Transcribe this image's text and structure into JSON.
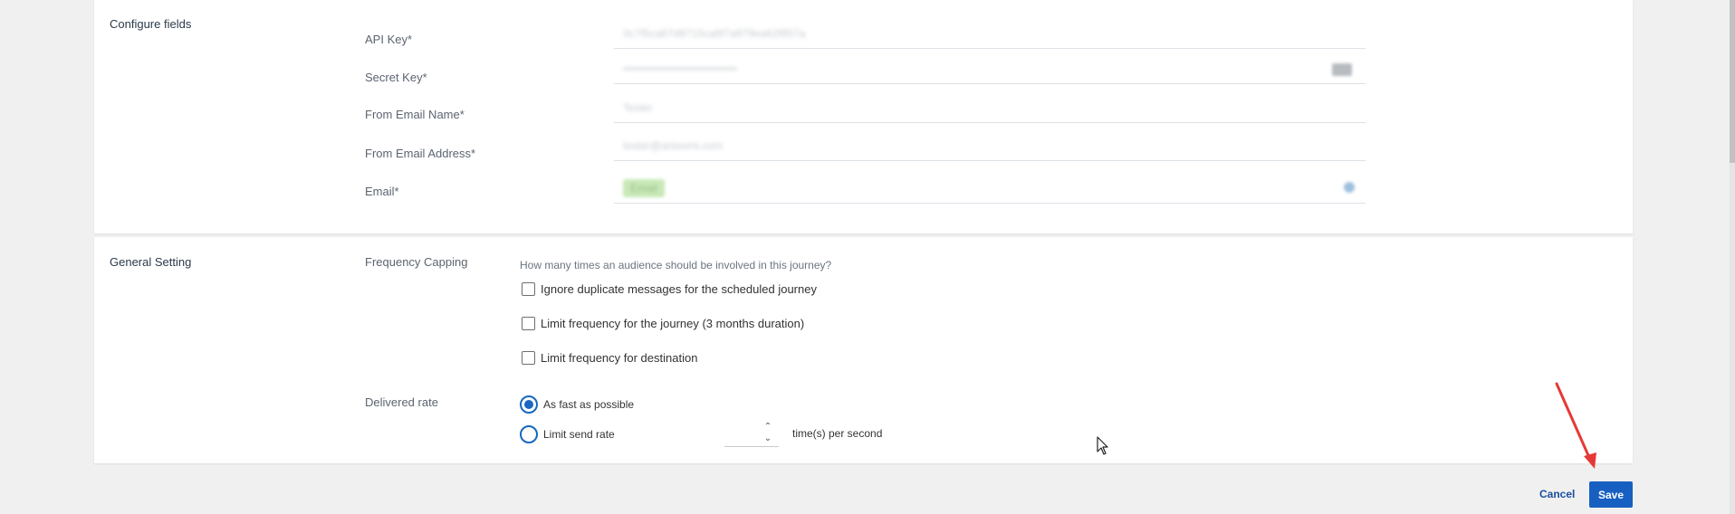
{
  "configure": {
    "title": "Configure fields",
    "fields": [
      {
        "label": "API Key*",
        "value": "0c7f5ca87d9715ca6f7a979ea62f957a"
      },
      {
        "label": "Secret Key*",
        "value": "••••••••••••••••••••••••••••••"
      },
      {
        "label": "From Email Name*",
        "value": "Tester"
      },
      {
        "label": "From Email Address*",
        "value": "tester@antsomi.com"
      },
      {
        "label": "Email*",
        "value": "Email"
      }
    ]
  },
  "general": {
    "title": "General Setting",
    "frequency_label": "Frequency Capping",
    "question": "How many times an audience should be involved in this journey?",
    "options": [
      "Ignore duplicate messages for the scheduled journey",
      "Limit frequency for the journey (3 months duration)",
      "Limit frequency for destination"
    ],
    "delivered_label": "Delivered rate",
    "rate_fast": "As fast as possible",
    "rate_limit": "Limit send rate",
    "rate_suffix": "time(s) per second",
    "rate_selected": "As fast as possible"
  },
  "actions": {
    "cancel": "Cancel",
    "save": "Save"
  },
  "colors": {
    "primary": "#1760c2",
    "annotation": "#e53935"
  }
}
